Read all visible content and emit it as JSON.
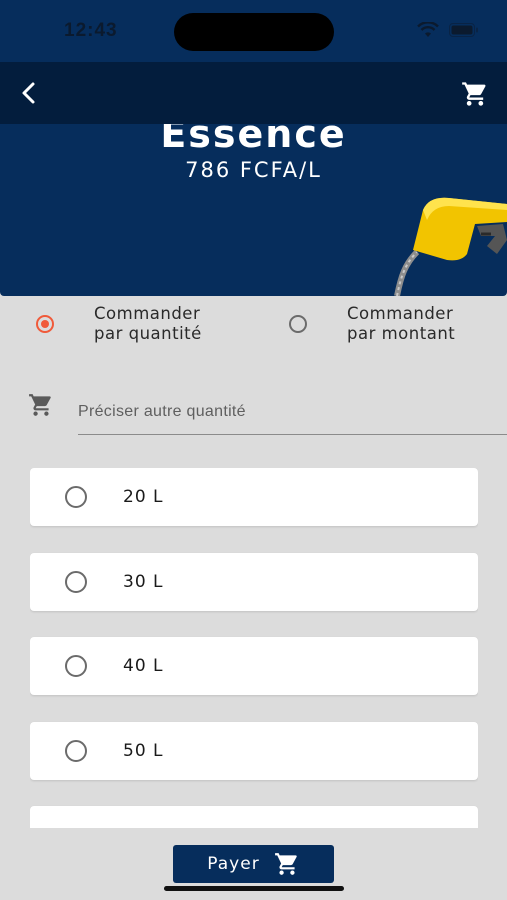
{
  "status_bar": {
    "time": "12:43"
  },
  "header": {
    "title": "Essence",
    "price": "786 FCFA/L",
    "back_icon": "back-chevron-icon",
    "cart_icon": "cart-icon"
  },
  "order_mode": {
    "options": [
      {
        "label": "Commander\npar quantité",
        "selected": true
      },
      {
        "label": "Commander\npar montant",
        "selected": false
      }
    ]
  },
  "custom_quantity": {
    "placeholder": "Préciser autre quantité",
    "value": ""
  },
  "quantities": [
    {
      "label": "20 L",
      "selected": false
    },
    {
      "label": "30 L",
      "selected": false
    },
    {
      "label": "40 L",
      "selected": false
    },
    {
      "label": "50 L",
      "selected": false
    },
    {
      "label": "",
      "selected": false
    }
  ],
  "footer": {
    "pay_label": "Payer"
  },
  "colors": {
    "brand": "#062d5c",
    "accent": "#f05a3a",
    "background": "#dcdcdc"
  }
}
